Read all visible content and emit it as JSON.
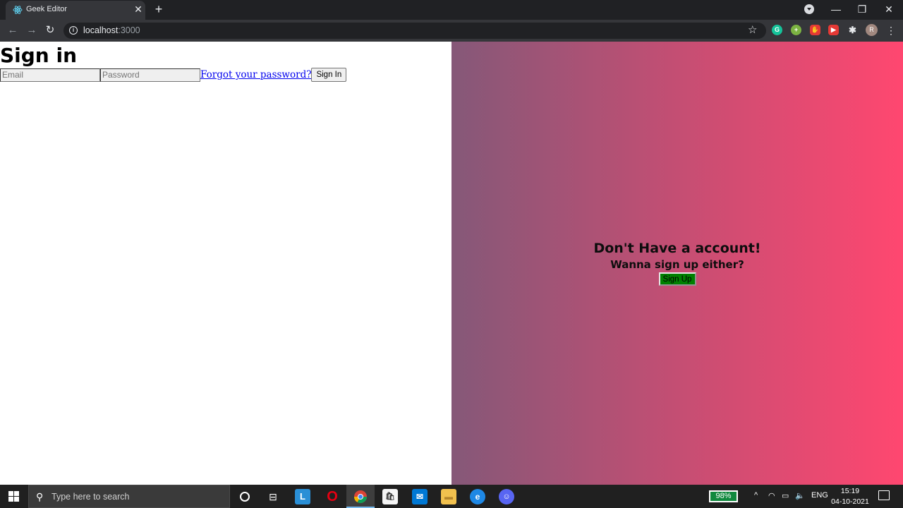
{
  "browser": {
    "tab_title": "Geek Editor",
    "url_host": "localhost",
    "url_port": ":3000",
    "avatar_letter": "R"
  },
  "signin": {
    "title": "Sign in",
    "email_placeholder": "Email",
    "password_placeholder": "Password",
    "forgot_label": "Forgot your password?",
    "button_label": "Sign In"
  },
  "signup_panel": {
    "title": "Don't Have a account!",
    "subtitle": "Wanna sign up either?",
    "button_label": "Sign Up",
    "button_color": "#008000",
    "gradient_start": "#855878",
    "gradient_end": "#ff4770"
  },
  "taskbar": {
    "search_placeholder": "Type here to search",
    "battery": "98%",
    "language": "ENG",
    "time": "15:19",
    "date": "04-10-2021"
  }
}
